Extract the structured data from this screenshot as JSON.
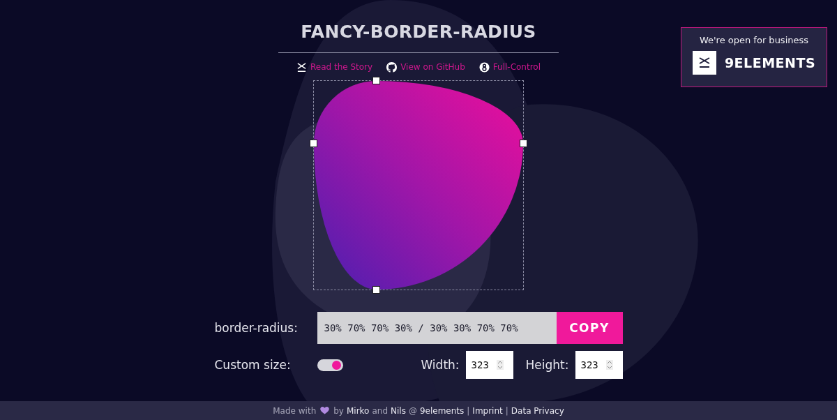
{
  "title": "FANCY-BORDER-RADIUS",
  "links": [
    {
      "kind": "story",
      "label": "Read the Story"
    },
    {
      "kind": "github",
      "label": "View on GitHub"
    },
    {
      "kind": "eight",
      "label": "Full-Control"
    }
  ],
  "promo": {
    "text": "We're open for business",
    "brand": "9ELEMENTS"
  },
  "border_radius": {
    "label": "border-radius:",
    "value": "30% 70% 70% 30% / 30% 30% 70% 70%",
    "button": "COPY"
  },
  "custom_size": {
    "label": "Custom size:",
    "on": true
  },
  "width": {
    "label": "Width:",
    "value": "323"
  },
  "height": {
    "label": "Height:",
    "value": "323"
  },
  "footer": [
    {
      "kind": "text",
      "text": "Made with"
    },
    {
      "kind": "heart"
    },
    {
      "kind": "text",
      "text": "by"
    },
    {
      "kind": "link",
      "text": "Mirko"
    },
    {
      "kind": "text",
      "text": "and"
    },
    {
      "kind": "link",
      "text": "Nils"
    },
    {
      "kind": "text",
      "text": "@"
    },
    {
      "kind": "link",
      "text": "9elements"
    },
    {
      "kind": "text",
      "text": "|"
    },
    {
      "kind": "link",
      "text": "Imprint"
    },
    {
      "kind": "text",
      "text": "|"
    },
    {
      "kind": "link",
      "text": "Data Privacy"
    }
  ]
}
